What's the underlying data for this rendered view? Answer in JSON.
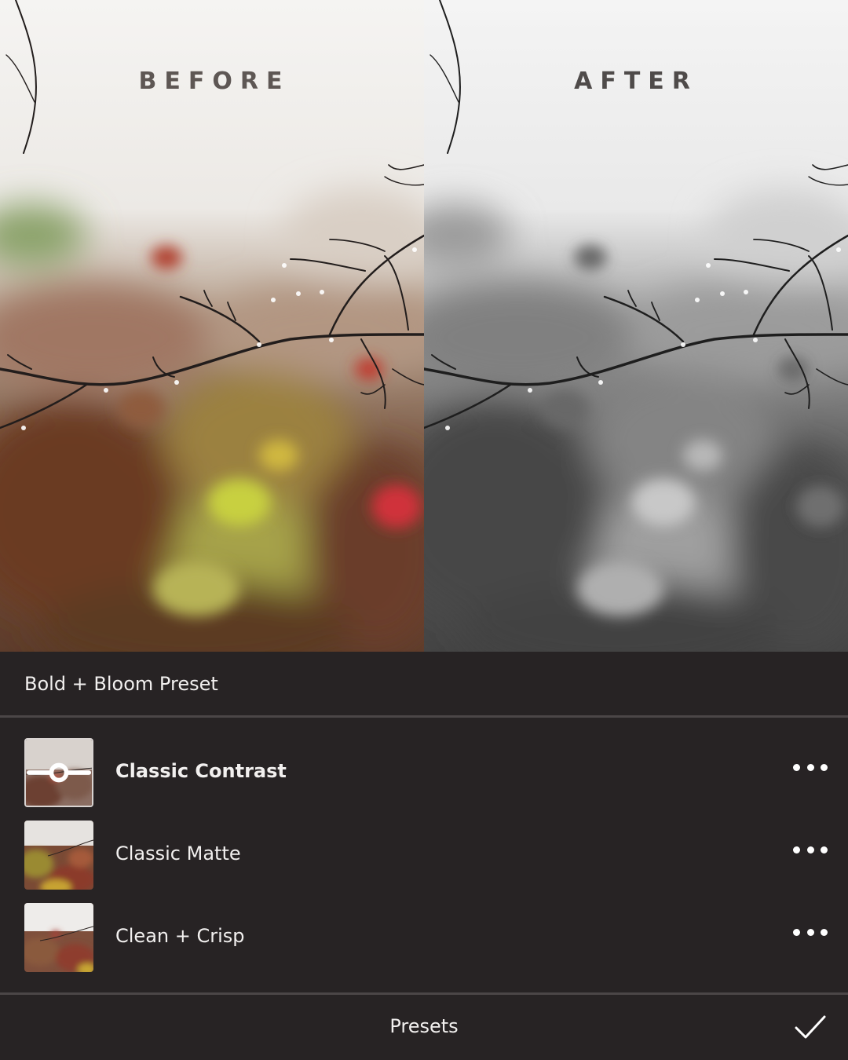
{
  "comparison": {
    "before_label": "BEFORE",
    "after_label": "AFTER"
  },
  "panel": {
    "group_title": "Bold + Bloom Preset",
    "presets": [
      {
        "name": "Classic Contrast",
        "selected": true
      },
      {
        "name": "Classic Matte",
        "selected": false
      },
      {
        "name": "Clean + Crisp",
        "selected": false
      }
    ],
    "bottom_title": "Presets"
  },
  "icons": {
    "more": "more-options-icon",
    "confirm": "checkmark-icon",
    "adjust": "slider-adjust-icon"
  },
  "colors": {
    "panel_bg": "#272324",
    "divider": "#4b4647",
    "label_text": "#5e5754"
  }
}
